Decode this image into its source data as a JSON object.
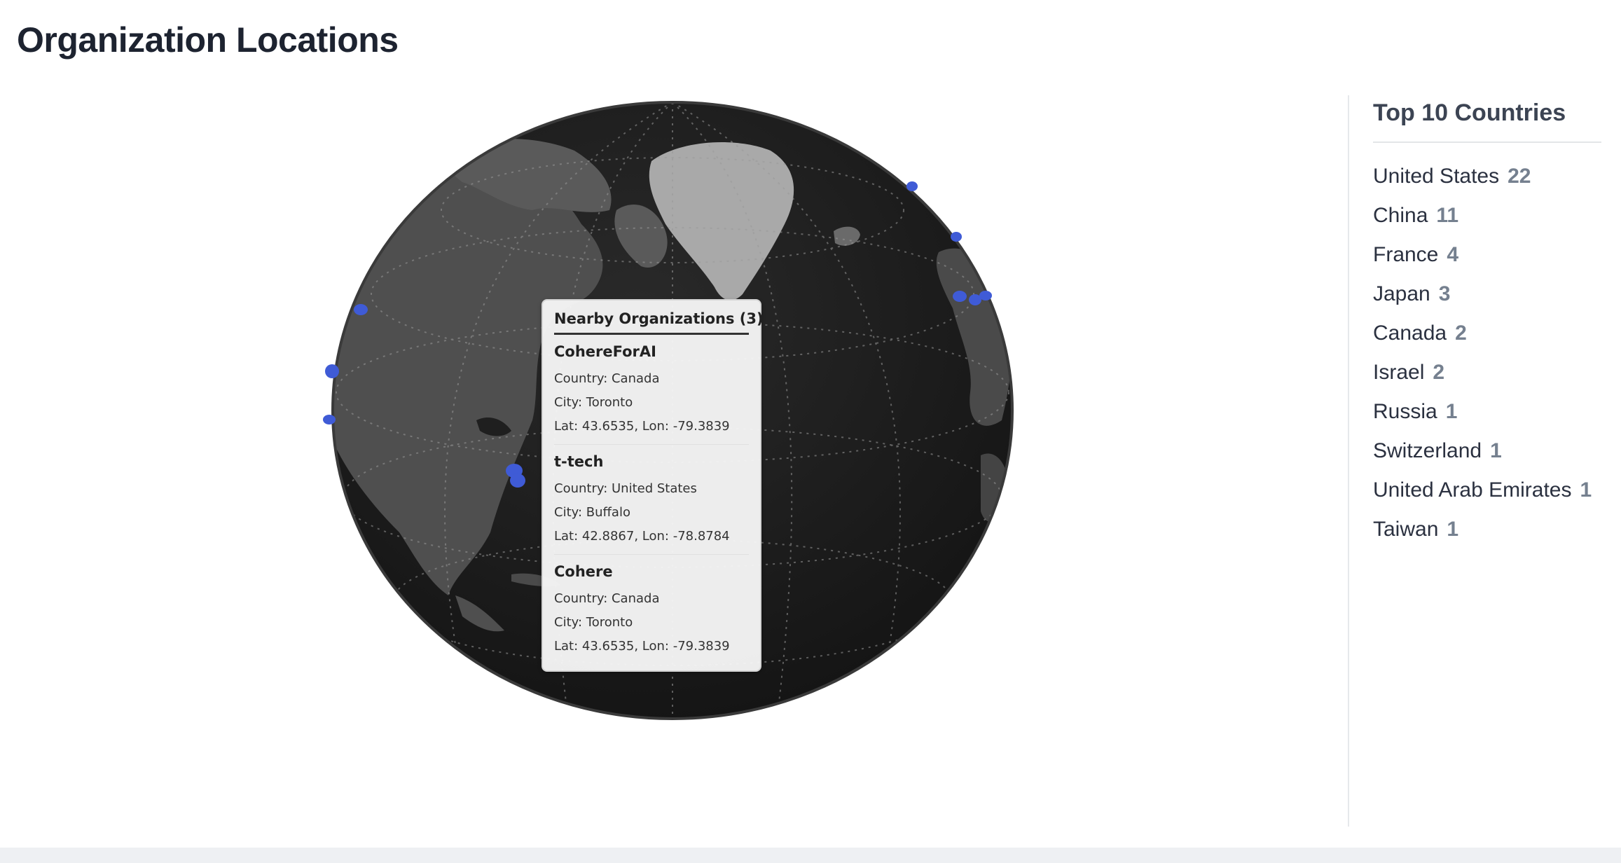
{
  "page": {
    "title": "Organization Locations"
  },
  "globe": {
    "land_color": "#555555",
    "greenland_color": "#a9a9a9",
    "ocean_color": "#1b1b1b",
    "marker_color": "#3f5bd6",
    "marker_count": 12
  },
  "tooltip": {
    "title": "Nearby Organizations (3)",
    "organizations": [
      {
        "name": "CohereForAI",
        "country": "Country: Canada",
        "city": "City: Toronto",
        "coords": "Lat: 43.6535, Lon: -79.3839"
      },
      {
        "name": "t-tech",
        "country": "Country: United States",
        "city": "City: Buffalo",
        "coords": "Lat: 42.8867, Lon: -78.8784"
      },
      {
        "name": "Cohere",
        "country": "Country: Canada",
        "city": "City: Toronto",
        "coords": "Lat: 43.6535, Lon: -79.3839"
      }
    ]
  },
  "sidebar": {
    "title": "Top 10 Countries",
    "countries": [
      {
        "name": "United States",
        "count": "22"
      },
      {
        "name": "China",
        "count": "11"
      },
      {
        "name": "France",
        "count": "4"
      },
      {
        "name": "Japan",
        "count": "3"
      },
      {
        "name": "Canada",
        "count": "2"
      },
      {
        "name": "Israel",
        "count": "2"
      },
      {
        "name": "Russia",
        "count": "1"
      },
      {
        "name": "Switzerland",
        "count": "1"
      },
      {
        "name": "United Arab Emirates",
        "count": "1"
      },
      {
        "name": "Taiwan",
        "count": "1"
      }
    ]
  }
}
